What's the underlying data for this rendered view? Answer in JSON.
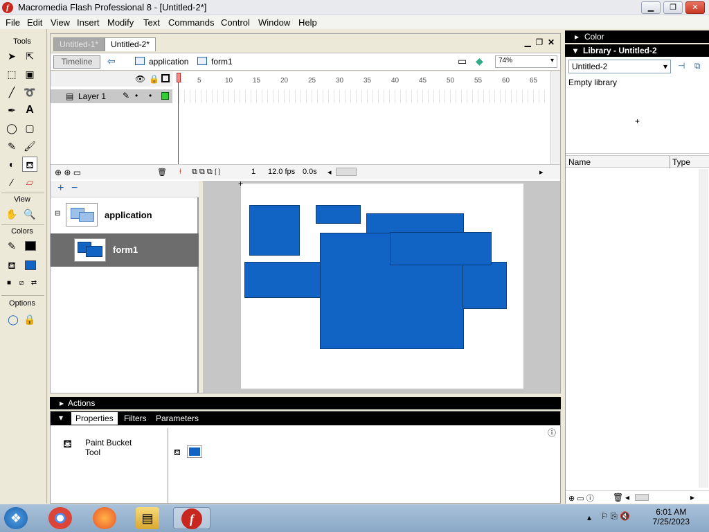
{
  "window": {
    "title": "Macromedia Flash Professional 8 - [Untitled-2*]",
    "controls": [
      "minimize",
      "restore",
      "close"
    ]
  },
  "menu": [
    "File",
    "Edit",
    "View",
    "Insert",
    "Modify",
    "Text",
    "Commands",
    "Control",
    "Window",
    "Help"
  ],
  "tools": {
    "header": "Tools",
    "view_header": "View",
    "colors_header": "Colors",
    "options_header": "Options",
    "selected_tool": "paint-bucket",
    "stroke_color": "#000000",
    "fill_color": "#1164c4"
  },
  "document": {
    "tabs": [
      "Untitled-1*",
      "Untitled-2*"
    ],
    "active_tab": "Untitled-2*",
    "timeline_button": "Timeline",
    "breadcrumb": [
      "application",
      "form1"
    ],
    "zoom": "74%"
  },
  "timeline": {
    "layer_name": "Layer 1",
    "frame_numbers": [
      "1",
      "5",
      "10",
      "15",
      "20",
      "25",
      "30",
      "35",
      "40",
      "45",
      "50",
      "55",
      "60",
      "65"
    ],
    "current_frame": "1",
    "fps": "12.0 fps",
    "elapsed": "0.0s"
  },
  "screens": [
    {
      "name": "application",
      "selected": false
    },
    {
      "name": "form1",
      "selected": true
    }
  ],
  "panels": {
    "actions_label": "Actions",
    "property_tabs": [
      "Properties",
      "Filters",
      "Parameters"
    ],
    "tool_name": "Paint Bucket\nTool",
    "color_label": "Color",
    "library_label": "Library - Untitled-2",
    "library_select": "Untitled-2",
    "library_empty": "Empty library",
    "library_cols": [
      "Name",
      "Type"
    ]
  },
  "taskbar": {
    "time": "6:01 AM",
    "date": "7/25/2023"
  }
}
